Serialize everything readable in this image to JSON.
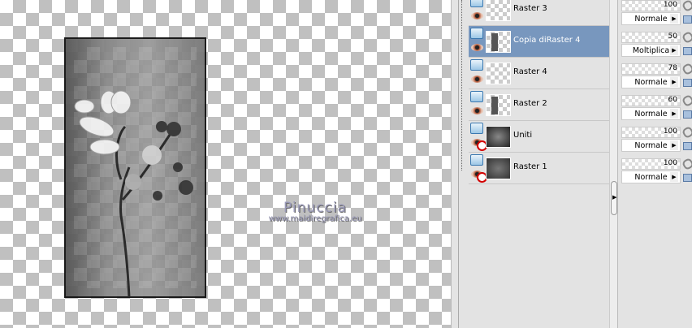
{
  "watermark": {
    "name": "Pinuccia",
    "url": "www.maidiregrafica.eu"
  },
  "layers": [
    {
      "name": "Raster 3",
      "visible": true,
      "selected": false,
      "opacity": "100",
      "blend": "Normale"
    },
    {
      "name": "Copia diRaster 4",
      "visible": true,
      "selected": true,
      "opacity": "50",
      "blend": "Moltiplica"
    },
    {
      "name": "Raster 4",
      "visible": true,
      "selected": false,
      "opacity": "78",
      "blend": "Normale"
    },
    {
      "name": "Raster 2",
      "visible": true,
      "selected": false,
      "opacity": "60",
      "blend": "Normale"
    },
    {
      "name": "Uniti",
      "visible": false,
      "selected": false,
      "opacity": "100",
      "blend": "Normale"
    },
    {
      "name": "Raster 1",
      "visible": false,
      "selected": false,
      "opacity": "100",
      "blend": "Normale"
    }
  ],
  "colors": {
    "selection": "#7897be"
  }
}
